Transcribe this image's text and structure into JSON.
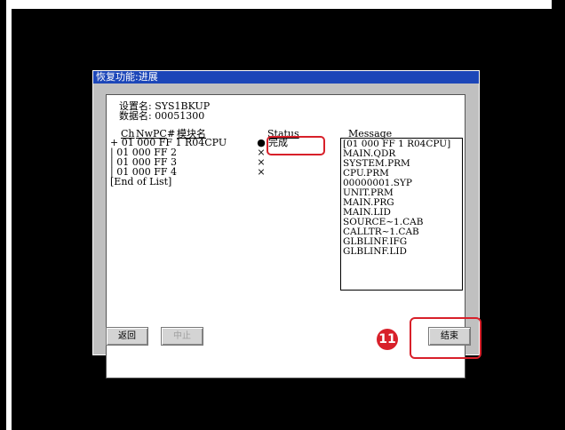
{
  "window": {
    "title": "恢复功能:进展"
  },
  "info": {
    "setting_label": "设置名:",
    "setting_value": "SYS1BKUP",
    "data_label": "数据名:",
    "data_value": "00051300"
  },
  "list_header": {
    "ch": "Ch",
    "nw": "Nw",
    "pc": "PC",
    "hash": "#",
    "module": "模块名",
    "status": "Status",
    "message": "Message"
  },
  "list_rows": [
    {
      "text": "+ 01 000 FF 1 R04CPU",
      "mark": "●",
      "status": "完成"
    },
    {
      "text": "| 01 000 FF 2",
      "mark": "×",
      "status": ""
    },
    {
      "text": "| 01 000 FF 3",
      "mark": "×",
      "status": ""
    },
    {
      "text": "| 01 000 FF 4",
      "mark": "×",
      "status": ""
    },
    {
      "text": "[End of List]",
      "mark": "",
      "status": ""
    }
  ],
  "messages": [
    "[01 000 FF 1 R04CPU]",
    "MAIN.QDR",
    "SYSTEM.PRM",
    "CPU.PRM",
    "00000001.SYP",
    "UNIT.PRM",
    "MAIN.PRG",
    "MAIN.LID",
    "SOURCE~1.CAB",
    "CALLTR~1.CAB",
    "GLBLINF.IFG",
    "GLBLINF.LID"
  ],
  "buttons": {
    "back": "返回",
    "stop": "中止",
    "end": "结束"
  },
  "step_badge": "11",
  "colors": {
    "titlebar": "#1c46b8",
    "highlight": "#d8202a",
    "window_bg": "#c0c0c0"
  }
}
